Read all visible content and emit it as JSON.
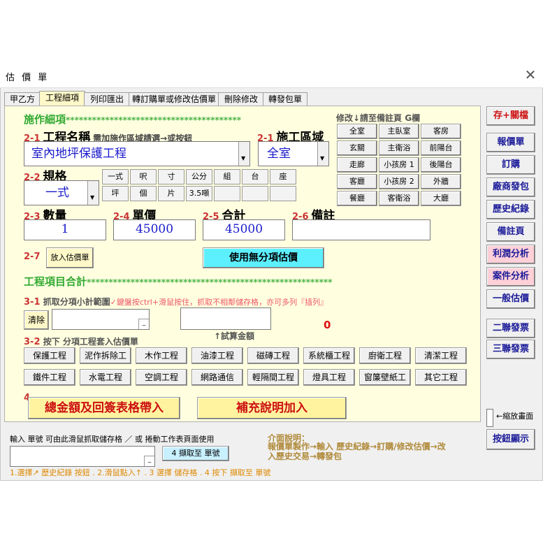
{
  "window": {
    "title": "估 價 單"
  },
  "tabs": [
    "甲乙方",
    "工程細項",
    "列印匯出",
    "轉訂購單或修改估價單",
    "刪除修改",
    "轉發包單"
  ],
  "section1": {
    "title": "施作細項",
    "stars": "****************************************"
  },
  "room_hint": "修改↓請至備註頁 G欄",
  "rooms": [
    "全室",
    "主臥室",
    "客房",
    "玄關",
    "主衛浴",
    "前陽台",
    "走廊",
    "小孩房 1",
    "後陽台",
    "客廳",
    "小孩房 2",
    "外牆",
    "餐廳",
    "客衛浴",
    "大廳"
  ],
  "f21": {
    "num": "2-1",
    "label": "工程名稱",
    "hint": "需加施作區域請選→或按鈕",
    "value": "室內地坪保護工程"
  },
  "f21b": {
    "num": "2-1",
    "label": "施工區域",
    "value": "全室"
  },
  "f22": {
    "num": "2-2",
    "label": "規格",
    "value": "一式",
    "units_row1": [
      "一式",
      "呎",
      "寸",
      "公分",
      "組",
      "台",
      "座"
    ],
    "units_row2": [
      "坪",
      "個",
      "片",
      "3.5噸",
      "",
      "",
      ""
    ]
  },
  "f23": {
    "num": "2-3",
    "label": "數量",
    "value": "1"
  },
  "f24": {
    "num": "2-4",
    "label": "單價",
    "value": "45000"
  },
  "f25": {
    "num": "2-5",
    "label": "合計",
    "value": "45000"
  },
  "f26": {
    "num": "2-6",
    "label": "備註",
    "value": ""
  },
  "f27": {
    "num": "2-7",
    "button": "放入估價單"
  },
  "noitem_button": "使用無分項估價",
  "section2": {
    "title": "工程項目合計",
    "stars": "********************************************************"
  },
  "s31": {
    "num": "3-1",
    "label": "抓取分項小計範圍",
    "hint": "✓鍵盤按ctrl+滑鼠按住，抓取不相鄰儲存格，亦可多列『插列』",
    "clear": "清除",
    "calc_label": "↑試算金額",
    "calc_value": "0"
  },
  "s32": {
    "num": "3-2",
    "label": "按下 分項工程套入估價單"
  },
  "categories": [
    "保護工程",
    "泥作拆除工",
    "木作工程",
    "油漆工程",
    "磁磚工程",
    "系統櫃工程",
    "廚衛工程",
    "清潔工程",
    "鐵件工程",
    "水電工程",
    "空調工程",
    "網路通信",
    "輕隔間工程",
    "燈具工程",
    "窗簾壁紙工",
    "其它工程"
  ],
  "s4": {
    "num": "4",
    "total_button": "總金額及回簽表格帶入",
    "explain_button": "補充說明加入"
  },
  "bottom": {
    "instruction": "輸入 單號  可由此滑鼠抓取儲存格 ／ 或 捲動工作表頁面使用",
    "fetch_button": "4  擷取至 單號",
    "help_title": "介面說明：",
    "help_text": "報價單製作→輸入 歷史紀錄→訂購/修改估價→改入歷史交易→轉發包",
    "steps": "1.選擇↗ 歷史紀錄 按鈕 . 2.滑鼠點入↑ . 3 選擇 儲存格 . 4 按下 擷取至 單號"
  },
  "side_buttons": [
    "存+關檔",
    "報價單",
    "訂購",
    "廠商發包",
    "歷史紀錄",
    "備註頁",
    "利潤分析",
    "案件分析",
    "一般估價",
    "二聯發票",
    "三聯發票"
  ],
  "shrink_label": "←縮放畫面",
  "toggle_button": "按鈕顯示",
  "colors": {
    "accent_green": "#33aa33",
    "number_red": "#cc3333",
    "value_blue": "#1a1acc",
    "panel_yellow": "#ffffe0"
  }
}
